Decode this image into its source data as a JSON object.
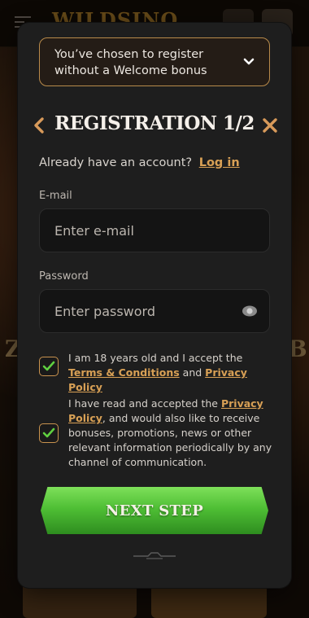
{
  "background": {
    "logo": "WILDSINO",
    "side_letter_left": "Z",
    "side_letter_right": "B"
  },
  "modal": {
    "bonus_select": {
      "label": "You’ve chosen to register without a Welcome bonus",
      "icon": "chevron-down-icon"
    },
    "title": "REGISTRATION 1/2",
    "back_icon": "chevron-left-icon",
    "close_icon": "close-icon",
    "account_prompt": "Already have an account?",
    "login_link": "Log in",
    "email": {
      "label": "E-mail",
      "placeholder": "Enter e-mail",
      "value": ""
    },
    "password": {
      "label": "Password",
      "placeholder": "Enter password",
      "value": "",
      "icon": "eye-icon"
    },
    "consent_age": {
      "checked": true,
      "text_before": "I am 18 years old and I accept the",
      "terms_link": "Terms & Conditions",
      "and": "and",
      "privacy_link": "Privacy Policy"
    },
    "consent_marketing": {
      "checked": true,
      "text_before": "I have read and accepted the",
      "privacy_link": "Privacy Policy",
      "text_after": ", and would also like to receive bonuses, promotions, news or other relevant information periodically by any channel of communication."
    },
    "next_button": "NEXT STEP"
  },
  "colors": {
    "accent": "#d8a055",
    "border_gold": "#b88a4a",
    "button_green": "#4fbf35",
    "modal_bg": "#1e1e1e"
  }
}
